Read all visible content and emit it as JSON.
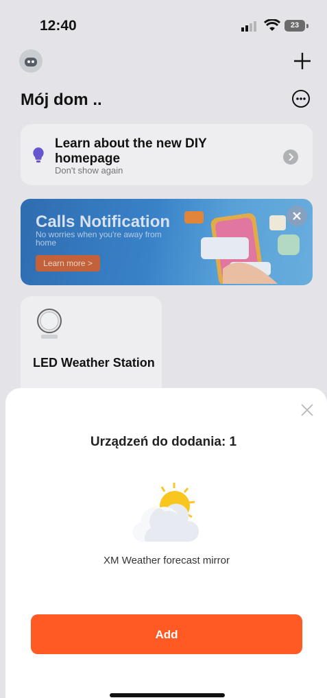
{
  "status_bar": {
    "time": "12:40",
    "battery": "23"
  },
  "header": {
    "title": "Mój dom .."
  },
  "diy_card": {
    "title": "Learn about the new DIY homepage",
    "subtitle": "Don't show again"
  },
  "banner": {
    "title": "Calls Notification",
    "subtitle": "No worries when you're away from home",
    "button_label": "Learn more >"
  },
  "device_card": {
    "name": "LED Weather Station"
  },
  "sheet": {
    "title": "Urządzeń do dodania: 1",
    "product_name": "XM Weather forecast mirror",
    "add_label": "Add"
  },
  "colors": {
    "accent": "#ff5a24",
    "banner": "#3a86cf",
    "bulb": "#6a57d6"
  },
  "icons": [
    "robot-avatar-icon",
    "plus-icon",
    "more-icon",
    "bulb-icon",
    "chevron-right-icon",
    "close-icon",
    "weather-station-icon",
    "sun-cloud-icon"
  ]
}
